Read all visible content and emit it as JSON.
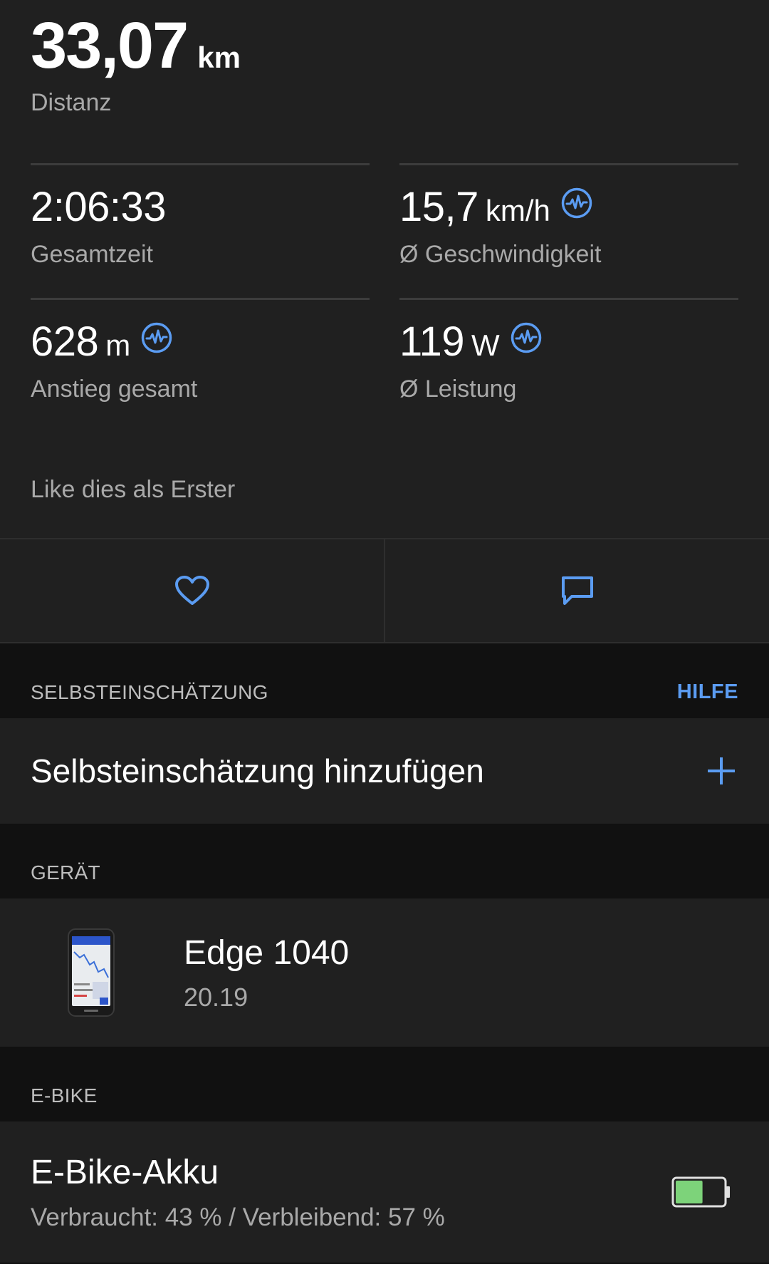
{
  "summary": {
    "distance_value": "33,07",
    "distance_unit": "km",
    "distance_label": "Distanz"
  },
  "stats": {
    "total_time_value": "2:06:33",
    "total_time_label": "Gesamtzeit",
    "avg_speed_value": "15,7",
    "avg_speed_unit": "km/h",
    "avg_speed_label": "Ø Geschwindigkeit",
    "ascent_value": "628",
    "ascent_unit": "m",
    "ascent_label": "Anstieg gesamt",
    "avg_power_value": "119",
    "avg_power_unit": "W",
    "avg_power_label": "Ø Leistung"
  },
  "social": {
    "like_prompt": "Like dies als Erster"
  },
  "icons": {
    "metric": "performance-wave-icon",
    "like": "heart-icon",
    "comment": "comment-icon",
    "add": "plus-icon",
    "device": "edge-device-icon",
    "battery": "battery-icon"
  },
  "colors": {
    "accent": "#5b9cf2",
    "battery_fill": "#7dd37a"
  },
  "self_assessment": {
    "header": "SELBSTEINSCHÄTZUNG",
    "help_link": "HILFE",
    "add_label": "Selbsteinschätzung hinzufügen"
  },
  "device": {
    "header": "GERÄT",
    "name": "Edge 1040",
    "version": "20.19"
  },
  "ebike": {
    "header": "E-BIKE",
    "title": "E-Bike-Akku",
    "status": "Verbraucht: 43 % / Verbleibend: 57 %",
    "battery_remaining_fraction": 0.57
  }
}
